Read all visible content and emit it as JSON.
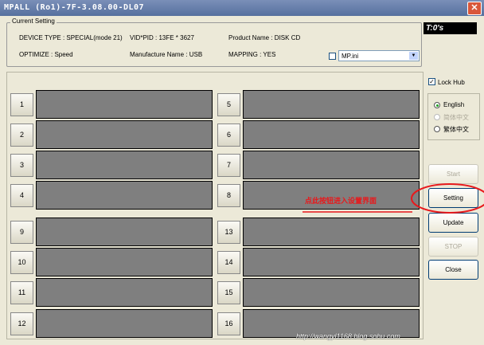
{
  "window": {
    "title": "MPALL (Ro1)-7F-3.08.00-DL07",
    "close_glyph": "✕"
  },
  "current_setting": {
    "label": "Current Setting",
    "device_type": "DEVICE TYPE : SPECIAL(mode 21)",
    "vid_pid": "VID*PID : 13FE * 3627",
    "product_name": "Product Name : DISK CD",
    "optimize": "OPTIMIZE : Speed",
    "manufacture_name": "Manufacture Name : USB",
    "mapping": "MAPPING : YES"
  },
  "timer": "T:0's",
  "ini_select": {
    "value": "MP.ini",
    "checked": false
  },
  "lock_hub": {
    "label": "Lock Hub",
    "checked": true,
    "check_glyph": "✓"
  },
  "language": {
    "options": [
      {
        "label": "English",
        "selected": true,
        "enabled": true
      },
      {
        "label": "简体中文",
        "selected": false,
        "enabled": false
      },
      {
        "label": "繁体中文",
        "selected": false,
        "enabled": true
      }
    ]
  },
  "buttons": {
    "start": "Start",
    "setting": "Setting",
    "update": "Update",
    "stop": "STOP",
    "close": "Close"
  },
  "ports": [
    "1",
    "2",
    "3",
    "4",
    "5",
    "6",
    "7",
    "8",
    "9",
    "10",
    "11",
    "12",
    "13",
    "14",
    "15",
    "16"
  ],
  "annotation": {
    "text": "点此按钮进入设置界面"
  },
  "watermark": "http://wangyl1168.blog.sohu.com",
  "colors": {
    "titlebar": "#56709e",
    "slot": "#7f7f7f",
    "annotation": "#e8191c"
  }
}
